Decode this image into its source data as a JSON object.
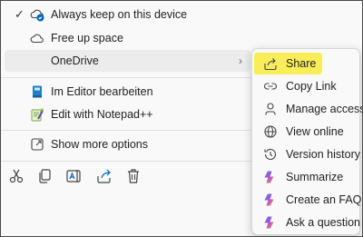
{
  "context_menu": {
    "items": [
      {
        "label": "Always keep on this device",
        "icon": "cloud-sync-icon",
        "checked": true,
        "check": "✓"
      },
      {
        "label": "Free up space",
        "icon": "cloud-icon"
      },
      {
        "label": "OneDrive",
        "icon": "",
        "has_submenu": true,
        "chevron": "›"
      },
      {
        "label": "Im Editor bearbeiten",
        "icon": "notebook-icon"
      },
      {
        "label": "Edit with Notepad++",
        "icon": "notepad-plus-plus-icon"
      },
      {
        "label": "Show more options",
        "icon": "expand-icon"
      }
    ],
    "toolbar": [
      "cut-icon",
      "copy-icon",
      "rename-icon",
      "share-icon",
      "delete-icon"
    ]
  },
  "onedrive_submenu": {
    "items": [
      {
        "label": "Share",
        "icon": "share-icon",
        "highlighted": true,
        "highlight_color": "#f9ee5a"
      },
      {
        "label": "Copy Link",
        "icon": "link-icon"
      },
      {
        "label": "Manage access",
        "icon": "person-icon"
      },
      {
        "label": "View online",
        "icon": "globe-icon"
      },
      {
        "label": "Version history",
        "icon": "history-icon"
      },
      {
        "label": "Summarize",
        "icon": "copilot-icon"
      },
      {
        "label": "Create an FAQ",
        "icon": "copilot-icon"
      },
      {
        "label": "Ask a question",
        "icon": "copilot-icon"
      }
    ]
  },
  "colors": {
    "menu_bg": "#f9f9f9",
    "hover_bg": "#ececec",
    "highlight": "#f9ee5a",
    "accent_blue": "#0067c0"
  }
}
